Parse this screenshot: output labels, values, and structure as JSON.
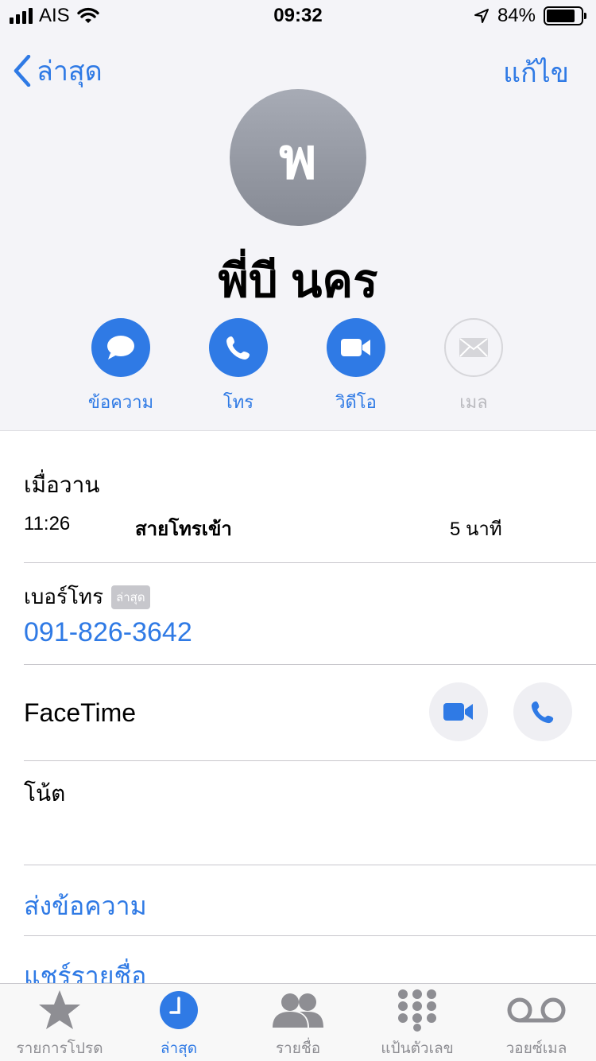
{
  "status_bar": {
    "carrier": "AIS",
    "time": "09:32",
    "battery_text": "84%",
    "battery_level": 0.84
  },
  "nav": {
    "back_label": "ล่าสุด",
    "edit_label": "แก้ไข"
  },
  "contact": {
    "initial": "พ",
    "name": "พี่บี นคร"
  },
  "actions": [
    {
      "label": "ข้อความ",
      "icon": "message-icon",
      "enabled": true
    },
    {
      "label": "โทร",
      "icon": "phone-icon",
      "enabled": true
    },
    {
      "label": "วิดีโอ",
      "icon": "video-icon",
      "enabled": true
    },
    {
      "label": "เมล",
      "icon": "mail-icon",
      "enabled": false
    }
  ],
  "recent": {
    "day": "เมื่อวาน",
    "time": "11:26",
    "type": "สายโทรเข้า",
    "duration": "5 นาที"
  },
  "phone": {
    "label": "เบอร์โทร",
    "badge": "ล่าสุด",
    "number": "091-826-3642"
  },
  "facetime": {
    "label": "FaceTime"
  },
  "notes": {
    "label": "โน้ต"
  },
  "links": {
    "send_message": "ส่งข้อความ",
    "share_contact": "แชร์รายชื่อ"
  },
  "tabs": [
    {
      "label": "รายการโปรด",
      "icon": "star-icon",
      "active": false
    },
    {
      "label": "ล่าสุด",
      "icon": "clock-icon",
      "active": true
    },
    {
      "label": "รายชื่อ",
      "icon": "contacts-icon",
      "active": false
    },
    {
      "label": "แป้นตัวเลข",
      "icon": "keypad-icon",
      "active": false
    },
    {
      "label": "วอยซ์เมล",
      "icon": "voicemail-icon",
      "active": false
    }
  ],
  "colors": {
    "accent": "#2f7ae5",
    "header_bg": "#f4f4f8",
    "disabled": "#b9b9be"
  }
}
